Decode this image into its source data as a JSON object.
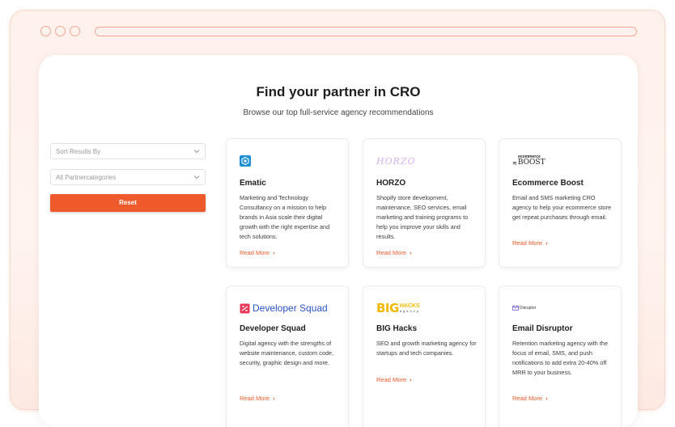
{
  "page": {
    "heading": "Find your partner in CRO",
    "subheading": "Browse our top full-service agency recommendations"
  },
  "filters": {
    "sort_placeholder": "Sort Results By",
    "category_placeholder": "All Partnercategories",
    "reset_label": "Reset"
  },
  "colors": {
    "accent": "#ee5a2b",
    "chrome": "#f0a894"
  },
  "partners": [
    {
      "name": "Ematic",
      "logo_text": "",
      "description": "Marketing and Technology Consultancy on a mission to help brands in Asia scale their digital growth with the right expertise and tech solutions.",
      "read_more": "Read More"
    },
    {
      "name": "HORZO",
      "logo_text": "HORZO",
      "description": "Shopify store development, maintenance, SEO services, email marketing and training programs to help you improve your skills and results.",
      "read_more": "Read More"
    },
    {
      "name": "Ecommerce Boost",
      "logo_text": "BOOST",
      "logo_small": "ecommerce",
      "description": "Email and SMS marketing CRO agency to help your ecommerce store get repeat purchases through email.",
      "read_more": "Read More"
    },
    {
      "name": "Developer Squad",
      "logo_text": "Developer Squad",
      "description": "Digital agency with the strengths of website maintenance, custom code, security, graphic design and more.",
      "read_more": "Read More"
    },
    {
      "name": "BIG Hacks",
      "logo_text": "BIG",
      "logo_small": "HACKS",
      "logo_tiny": "agency",
      "description": "SEO and growth marketing agency for startups and tech companies.",
      "read_more": "Read More"
    },
    {
      "name": "Email Disruptor",
      "logo_text": "Disruptor",
      "description": "Retention marketing agency with the focus of email, SMS, and push notifications to add extra 20-40% off MRR to your business.",
      "read_more": "Read More"
    }
  ]
}
